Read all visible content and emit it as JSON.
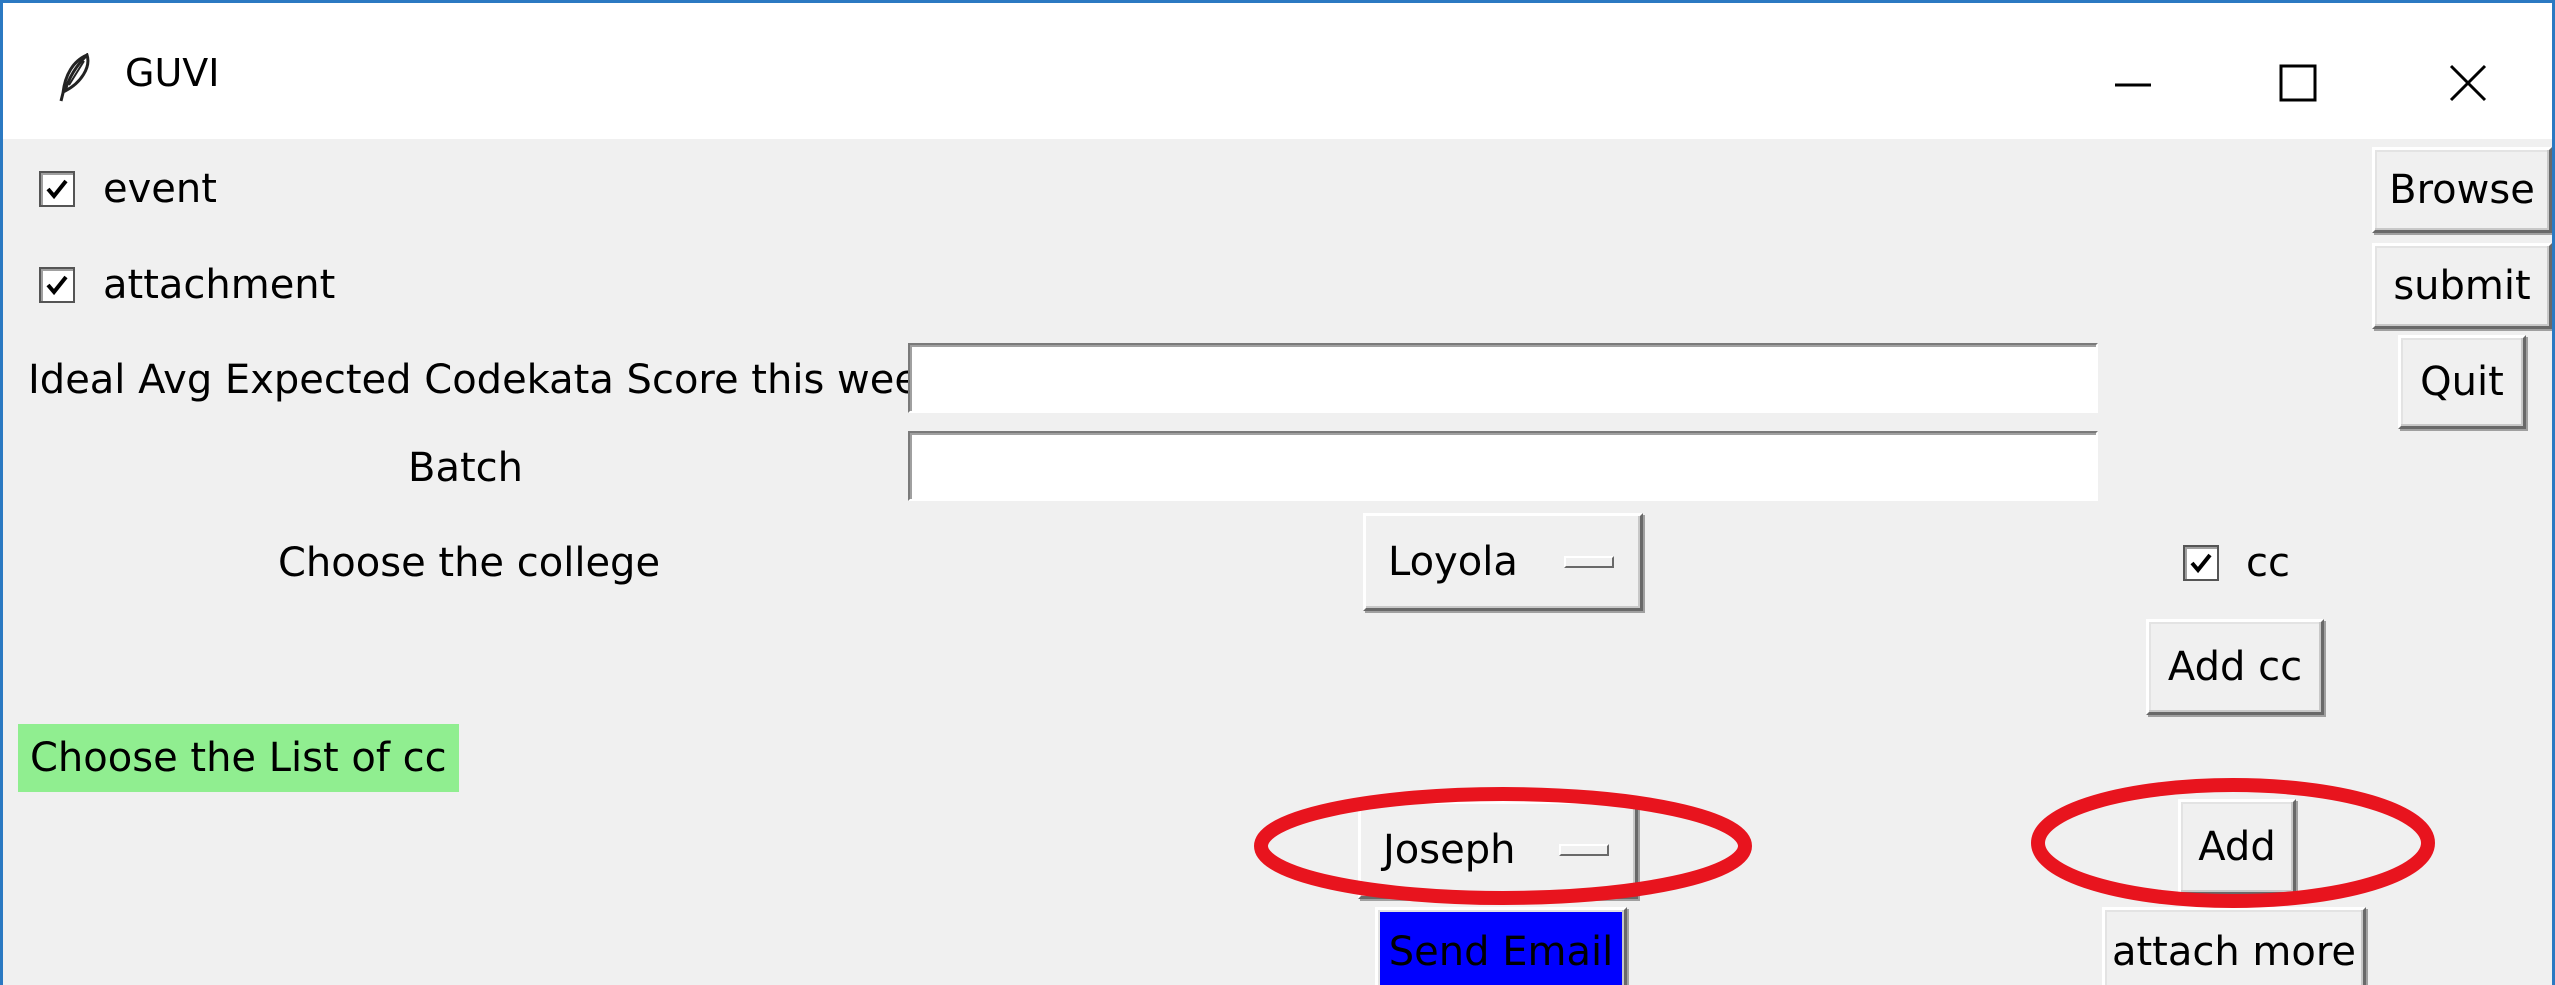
{
  "window": {
    "title": "GUVI",
    "icon": "feather-icon",
    "controls": [
      "minimize-icon",
      "maximize-icon",
      "close-icon"
    ]
  },
  "checkboxes": {
    "event": {
      "label": "event",
      "checked": true
    },
    "attachment": {
      "label": "attachment",
      "checked": true
    },
    "cc": {
      "label": "cc",
      "checked": true
    }
  },
  "fields": {
    "score_label": "Ideal Avg Expected Codekata Score this week",
    "score_value": "",
    "batch_label": "Batch",
    "batch_value": ""
  },
  "college": {
    "label": "Choose the college",
    "selected": "Loyola"
  },
  "cc_list": {
    "label": "Choose the List of cc",
    "label_bg": "#90ee90",
    "selected": "Joseph"
  },
  "buttons": {
    "browse": "Browse",
    "submit": "submit",
    "quit": "Quit",
    "add_cc": "Add cc",
    "add": "Add",
    "attach_more": "attach more",
    "send_email": "Send Email"
  },
  "colors": {
    "window_bg": "#f0f0f0",
    "border_accent": "#2b79c2",
    "send_email_bg": "#0000ff",
    "highlight_ellipse": "#e8141e"
  }
}
